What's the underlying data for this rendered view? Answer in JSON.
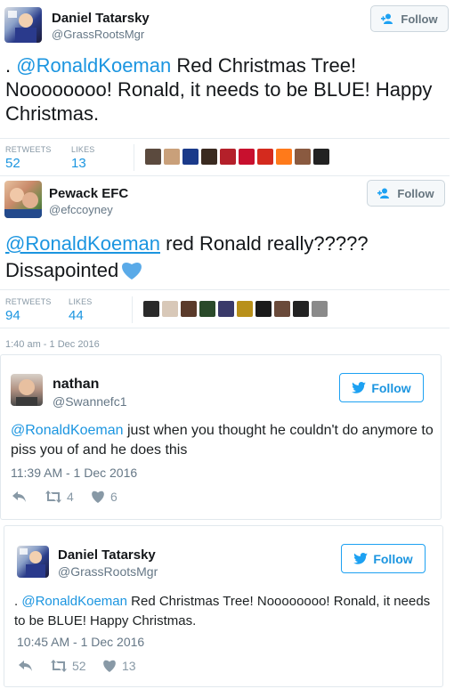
{
  "tweet1": {
    "name": "Daniel Tatarsky",
    "handle": "@GrassRootsMgr",
    "follow_label": "Follow",
    "text_prefix": ". ",
    "mention": "@RonaldKoeman",
    "text_rest": " Red Christmas Tree! Noooooooo! Ronald, it needs to be BLUE! Happy Christmas.",
    "retweets_label": "RETWEETS",
    "retweets": "52",
    "likes_label": "LIKES",
    "likes": "13"
  },
  "tweet2": {
    "name": "Pewack EFC",
    "handle": "@efccoyney",
    "follow_label": "Follow",
    "mention": "@RonaldKoeman",
    "text_rest": " red Ronald really????? Dissapointed",
    "retweets_label": "RETWEETS",
    "retweets": "94",
    "likes_label": "LIKES",
    "likes": "44",
    "timestamp": "1:40 am - 1 Dec 2016"
  },
  "embed1": {
    "name": "nathan",
    "handle": "@Swannefc1",
    "follow_label": "Follow",
    "mention": "@RonaldKoeman",
    "text_rest": " just when you thought he couldn't do anymore to piss you of and he does this",
    "timestamp": "11:39 AM - 1 Dec 2016",
    "retweets": "4",
    "likes": "6"
  },
  "embed2": {
    "name": "Daniel Tatarsky",
    "handle": "@GrassRootsMgr",
    "follow_label": "Follow",
    "text_prefix": ". ",
    "mention": "@RonaldKoeman",
    "text_rest": " Red Christmas Tree! Noooooooo! Ronald, it needs to be BLUE! Happy Christmas.",
    "timestamp": "10:45 AM - 1 Dec 2016",
    "retweets": "52",
    "likes": "13"
  },
  "colors": {
    "link": "#1b95e0",
    "heart": "#5aaae8",
    "divider": "#e6ecf0"
  },
  "icons": [
    "follow-user-icon",
    "twitter-bird-icon",
    "reply-icon",
    "retweet-icon",
    "like-heart-icon",
    "blue-heart-emoji"
  ]
}
